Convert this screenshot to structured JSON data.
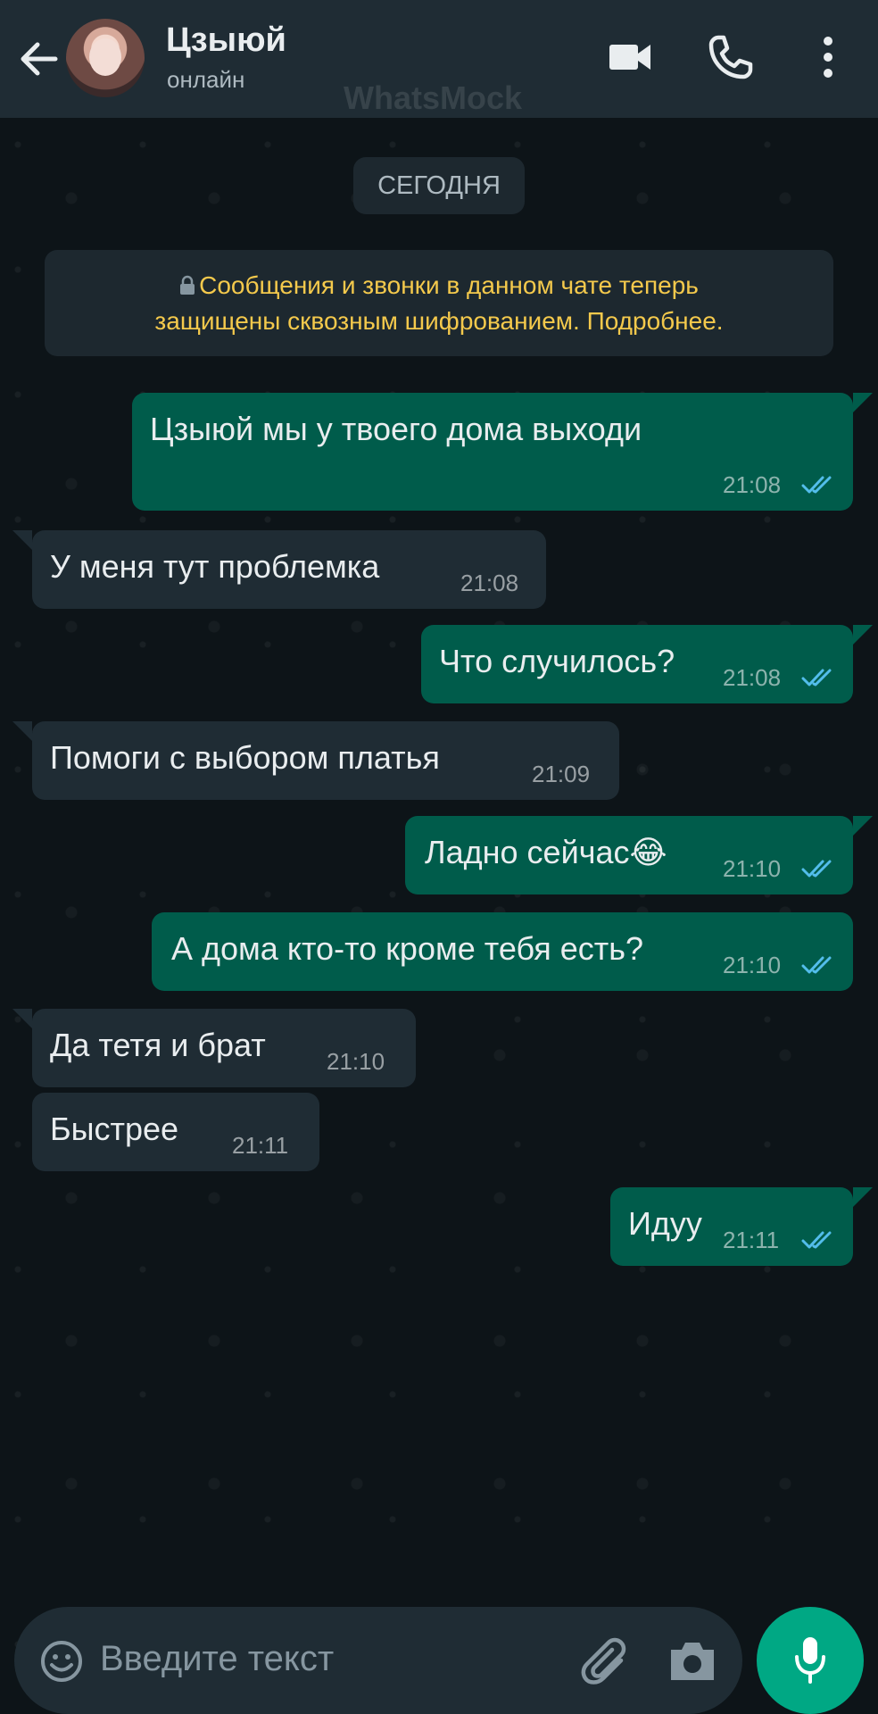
{
  "header": {
    "contact_name": "Цзыюй",
    "status": "онлайн",
    "watermark": "WhatsMock"
  },
  "chat": {
    "date_label": "СЕГОДНЯ",
    "encryption_notice_line1": "Сообщения и звонки в данном чате теперь",
    "encryption_notice_line2": "защищены сквозным шифрованием. Подробнее.",
    "messages": [
      {
        "direction": "out",
        "text": "Цзыюй мы у твоего дома выходи",
        "time": "21:08",
        "status": "read"
      },
      {
        "direction": "in",
        "text": "У меня тут проблемка",
        "time": "21:08"
      },
      {
        "direction": "out",
        "text": "Что случилось?",
        "time": "21:08",
        "status": "read"
      },
      {
        "direction": "in",
        "text": "Помоги с выбором платья",
        "time": "21:09"
      },
      {
        "direction": "out",
        "text": "Ладно сейчас",
        "emoji": "😂",
        "time": "21:10",
        "status": "read"
      },
      {
        "direction": "out",
        "text": "А дома кто-то кроме тебя есть?",
        "time": "21:10",
        "status": "read"
      },
      {
        "direction": "in",
        "text": "Да тетя и брат",
        "time": "21:10"
      },
      {
        "direction": "in",
        "text": "Быстрее",
        "time": "21:11"
      },
      {
        "direction": "out",
        "text": "Идуу",
        "time": "21:11",
        "status": "read"
      }
    ]
  },
  "composer": {
    "placeholder": "Введите текст"
  },
  "colors": {
    "header_bg": "#1f2c34",
    "chat_bg": "#0d1418",
    "outgoing_bubble": "#005c4b",
    "incoming_bubble": "#1f2c34",
    "read_ticks": "#53bdeb",
    "notice_text": "#f4c94c",
    "accent": "#00a884"
  },
  "icons": {
    "back": "arrow-left-icon",
    "video": "video-camera-icon",
    "call": "phone-icon",
    "menu": "more-vertical-icon",
    "lock": "lock-icon",
    "emoji": "smiley-icon",
    "attach": "paperclip-icon",
    "camera": "camera-icon",
    "mic": "microphone-icon"
  }
}
